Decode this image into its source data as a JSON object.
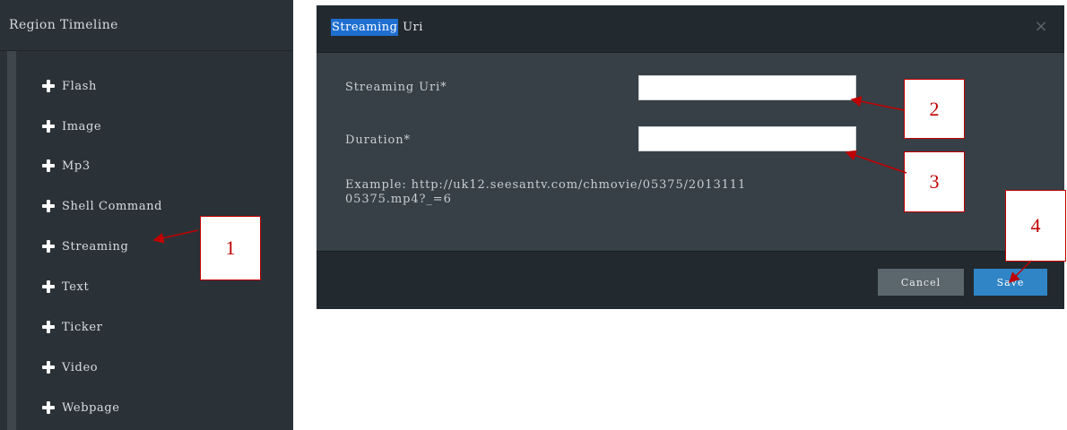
{
  "left_panel": {
    "title": "Region Timeline",
    "widgets": [
      {
        "label": "Flash"
      },
      {
        "label": "Image"
      },
      {
        "label": "Mp3"
      },
      {
        "label": "Shell Command"
      },
      {
        "label": "Streaming"
      },
      {
        "label": "Text"
      },
      {
        "label": "Ticker"
      },
      {
        "label": "Video"
      },
      {
        "label": "Webpage"
      }
    ]
  },
  "dialog": {
    "title_highlight": "Streaming",
    "title_rest": " Uri",
    "close_glyph": "×",
    "fields": [
      {
        "label": "Streaming Uri*",
        "value": "",
        "placeholder": ""
      },
      {
        "label": "Duration*",
        "value": "",
        "placeholder": ""
      }
    ],
    "example": "Example: http://uk12.seesantv.com/chmovie/05375/2013111\n05375.mp4?_=6",
    "buttons": {
      "cancel": "Cancel",
      "save": "Save"
    }
  },
  "annotations": [
    "1",
    "2",
    "3",
    "4"
  ],
  "colors": {
    "panel_bg": "#2b3237",
    "dialog_bg": "#374047",
    "header_bg": "#222a2f",
    "title_highlight": "#1f6fd0",
    "save_button": "#2f85c6",
    "cancel_button": "#5c666d",
    "annotation_red": "#c00000"
  }
}
